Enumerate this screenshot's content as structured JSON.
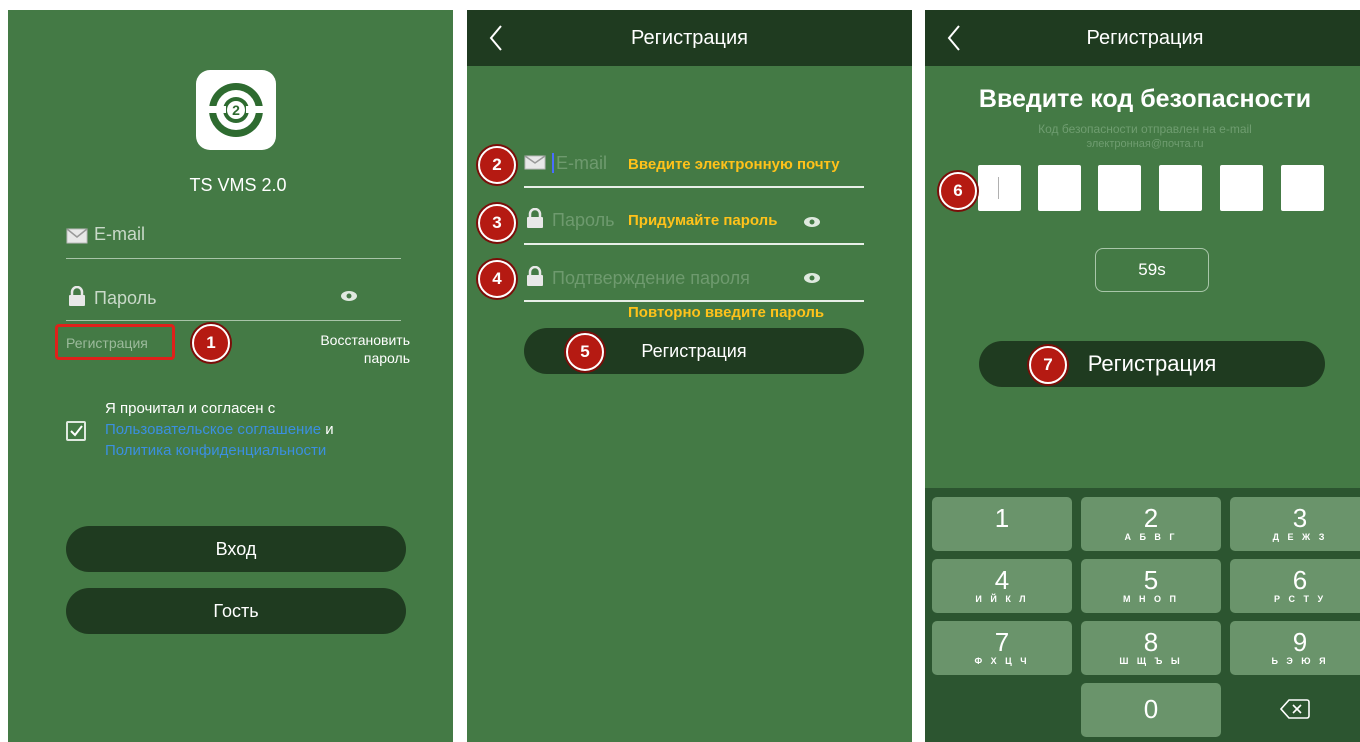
{
  "login": {
    "app_name": "TS VMS 2.0",
    "email_placeholder": "E-mail",
    "password_placeholder": "Пароль",
    "register_link": "Регистрация",
    "restore_line1": "Восстановить",
    "restore_line2": "пароль",
    "agree_text": "Я прочитал и согласен с",
    "user_agreement": "Пользовательское соглашение",
    "and": "и",
    "privacy_policy": "Политика конфиденциальности",
    "login_button": "Вход",
    "guest_button": "Гость",
    "badge": "1"
  },
  "register": {
    "title": "Регистрация",
    "email_placeholder": "E-mail",
    "password_placeholder": "Пароль",
    "confirm_placeholder": "Подтверждение пароля",
    "hint_email": "Введите электронную почту",
    "hint_password": "Придумайте пароль",
    "hint_confirm": "Повторно введите пароль",
    "register_button": "Регистрация",
    "badges": [
      "2",
      "3",
      "4",
      "5"
    ]
  },
  "verify": {
    "title": "Регистрация",
    "heading": "Введите код безопасности",
    "subtext": "Код безопасности отправлен на e-mail",
    "email": "электронная@почта.ru",
    "timer": "59s",
    "register_button": "Регистрация",
    "badges": [
      "6",
      "7"
    ],
    "keys": [
      {
        "num": "1",
        "letters": ""
      },
      {
        "num": "2",
        "letters": "А Б В Г"
      },
      {
        "num": "3",
        "letters": "Д Е Ж З"
      },
      {
        "num": "4",
        "letters": "И Й К Л"
      },
      {
        "num": "5",
        "letters": "М Н О П"
      },
      {
        "num": "6",
        "letters": "Р С Т У"
      },
      {
        "num": "7",
        "letters": "Ф Х Ц Ч"
      },
      {
        "num": "8",
        "letters": "Ш Щ Ъ Ы"
      },
      {
        "num": "9",
        "letters": "Ь Э Ю Я"
      },
      {
        "num": "0",
        "letters": ""
      }
    ]
  },
  "colors": {
    "background": "#447a45",
    "navbar": "#1f3b20",
    "hint": "#ffc21a",
    "badge": "#b51a12",
    "link": "#3b8fe0"
  }
}
